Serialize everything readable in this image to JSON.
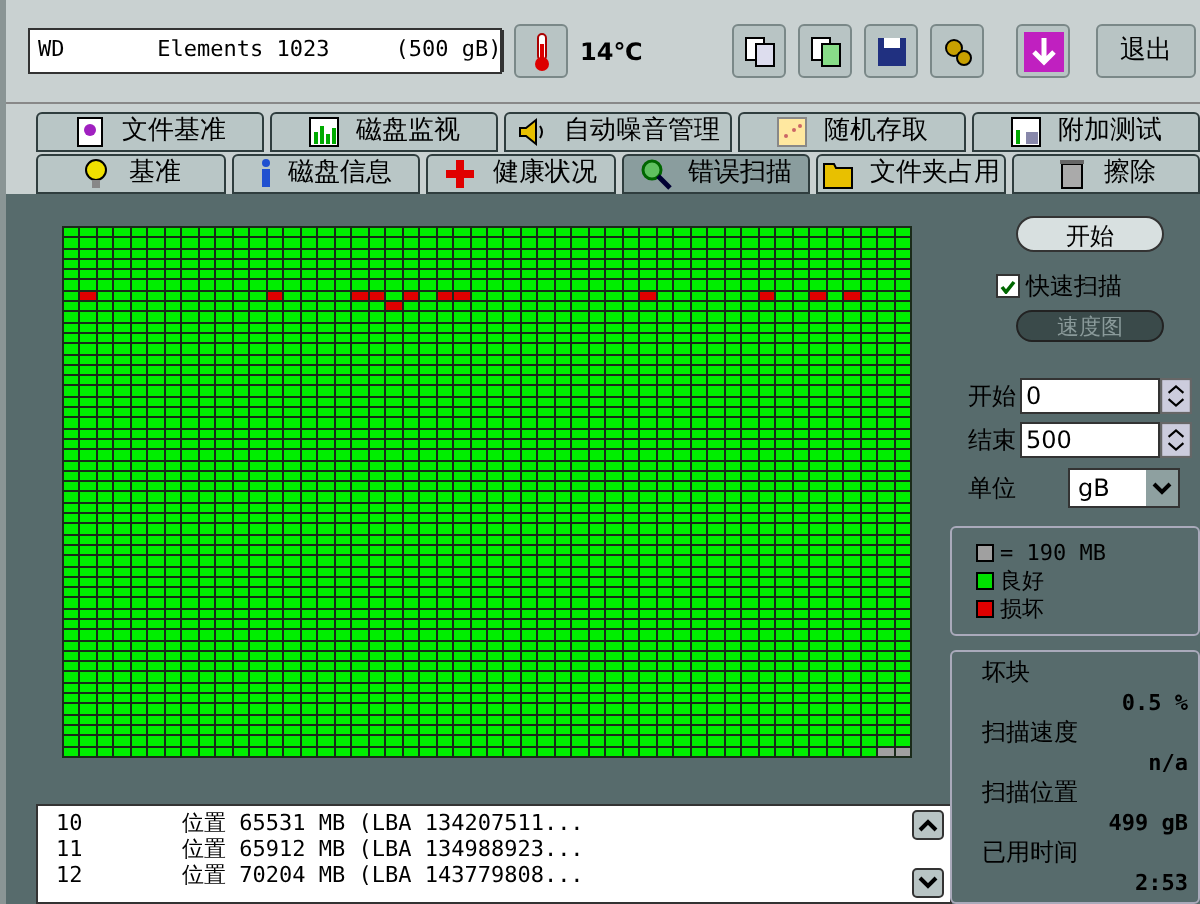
{
  "toolbar": {
    "drive": "WD       Elements 1023     (500 gB)",
    "temperature": "14℃",
    "exit_button": "退出"
  },
  "tabs_top": [
    {
      "label": "文件基准",
      "selected": false
    },
    {
      "label": "磁盘监视",
      "selected": false
    },
    {
      "label": "自动噪音管理",
      "selected": false
    },
    {
      "label": "随机存取",
      "selected": false
    },
    {
      "label": "附加测试",
      "selected": false
    }
  ],
  "tabs_bottom": [
    {
      "label": "基准",
      "selected": false
    },
    {
      "label": "磁盘信息",
      "selected": false
    },
    {
      "label": "健康状况",
      "selected": false
    },
    {
      "label": "错误扫描",
      "selected": true
    },
    {
      "label": "文件夹占用",
      "selected": false
    },
    {
      "label": "擦除",
      "selected": false
    }
  ],
  "scan_grid": [
    [
      false,
      false,
      false,
      false,
      false,
      false,
      false,
      false,
      false,
      false,
      false,
      false,
      false,
      false,
      false,
      false,
      false,
      false,
      false,
      false,
      false,
      false,
      false,
      false,
      false,
      false,
      false,
      false,
      false,
      false,
      false,
      false,
      false,
      false,
      false,
      false,
      false,
      false,
      false,
      false,
      false,
      false,
      false,
      false,
      false,
      false,
      false,
      false,
      false,
      false
    ],
    [
      false,
      false,
      false,
      false,
      false,
      false,
      false,
      false,
      false,
      false,
      false,
      false,
      false,
      false,
      false,
      false,
      false,
      false,
      false,
      false,
      false,
      false,
      false,
      false,
      false,
      false,
      false,
      false,
      false,
      false,
      false,
      false,
      false,
      false,
      false,
      false,
      false,
      false,
      false,
      false,
      false,
      false,
      false,
      false,
      false,
      false,
      false,
      false,
      false,
      false
    ],
    [
      false,
      false,
      false,
      false,
      false,
      false,
      false,
      false,
      false,
      false,
      false,
      false,
      false,
      false,
      false,
      false,
      false,
      false,
      false,
      false,
      false,
      false,
      false,
      false,
      false,
      false,
      false,
      false,
      false,
      false,
      false,
      false,
      false,
      false,
      false,
      false,
      false,
      false,
      false,
      false,
      false,
      false,
      false,
      false,
      false,
      false,
      false,
      false,
      false,
      false
    ],
    [
      false,
      false,
      false,
      false,
      false,
      false,
      false,
      false,
      false,
      false,
      false,
      false,
      false,
      false,
      false,
      false,
      false,
      false,
      false,
      false,
      false,
      false,
      false,
      false,
      false,
      false,
      false,
      false,
      false,
      false,
      false,
      false,
      false,
      false,
      false,
      false,
      false,
      false,
      false,
      false,
      false,
      false,
      false,
      false,
      false,
      false,
      false,
      false,
      false,
      false
    ],
    [
      false,
      false,
      false,
      false,
      false,
      false,
      false,
      false,
      false,
      false,
      false,
      false,
      false,
      false,
      false,
      false,
      false,
      false,
      false,
      false,
      false,
      false,
      false,
      false,
      false,
      false,
      false,
      false,
      false,
      false,
      false,
      false,
      false,
      false,
      false,
      false,
      false,
      false,
      false,
      false,
      false,
      false,
      false,
      false,
      false,
      false,
      false,
      false,
      false,
      false
    ],
    [
      false,
      false,
      false,
      false,
      false,
      false,
      false,
      false,
      false,
      false,
      false,
      false,
      false,
      false,
      false,
      false,
      false,
      false,
      false,
      false,
      false,
      false,
      false,
      false,
      false,
      false,
      false,
      false,
      false,
      false,
      false,
      false,
      false,
      false,
      false,
      false,
      false,
      false,
      false,
      false,
      false,
      false,
      false,
      false,
      false,
      false,
      false,
      false,
      false,
      false
    ],
    [
      false,
      true,
      false,
      false,
      false,
      false,
      false,
      false,
      false,
      false,
      false,
      false,
      true,
      false,
      false,
      false,
      false,
      true,
      true,
      false,
      true,
      false,
      true,
      true,
      false,
      false,
      false,
      false,
      false,
      false,
      false,
      false,
      false,
      false,
      true,
      false,
      false,
      false,
      false,
      false,
      false,
      true,
      false,
      false,
      true,
      false,
      true,
      false,
      false,
      false
    ],
    [
      false,
      false,
      false,
      false,
      false,
      false,
      false,
      false,
      false,
      false,
      false,
      false,
      false,
      false,
      false,
      false,
      false,
      false,
      false,
      true,
      false,
      false,
      false,
      false,
      false,
      false,
      false,
      false,
      false,
      false,
      false,
      false,
      false,
      false,
      false,
      false,
      false,
      false,
      false,
      false,
      false,
      false,
      false,
      false,
      false,
      false,
      false,
      false,
      false,
      false
    ],
    [
      false,
      false,
      false,
      false,
      false,
      false,
      false,
      false,
      false,
      false,
      false,
      false,
      false,
      false,
      false,
      false,
      false,
      false,
      false,
      false,
      false,
      false,
      false,
      false,
      false,
      false,
      false,
      false,
      false,
      false,
      false,
      false,
      false,
      false,
      false,
      false,
      false,
      false,
      false,
      false,
      false,
      false,
      false,
      false,
      false,
      false,
      false,
      false,
      false,
      false
    ],
    [
      false,
      false,
      false,
      false,
      false,
      false,
      false,
      false,
      false,
      false,
      false,
      false,
      false,
      false,
      false,
      false,
      false,
      false,
      false,
      false,
      false,
      false,
      false,
      false,
      false,
      false,
      false,
      false,
      false,
      false,
      false,
      false,
      false,
      false,
      false,
      false,
      false,
      false,
      false,
      false,
      false,
      false,
      false,
      false,
      false,
      false,
      false,
      false,
      false,
      false
    ],
    [
      false,
      false,
      false,
      false,
      false,
      false,
      false,
      false,
      false,
      false,
      false,
      false,
      false,
      false,
      false,
      false,
      false,
      false,
      false,
      false,
      false,
      false,
      false,
      false,
      false,
      false,
      false,
      false,
      false,
      false,
      false,
      false,
      false,
      false,
      false,
      false,
      false,
      false,
      false,
      false,
      false,
      false,
      false,
      false,
      false,
      false,
      false,
      false,
      false,
      false
    ],
    [
      false,
      false,
      false,
      false,
      false,
      false,
      false,
      false,
      false,
      false,
      false,
      false,
      false,
      false,
      false,
      false,
      false,
      false,
      false,
      false,
      false,
      false,
      false,
      false,
      false,
      false,
      false,
      false,
      false,
      false,
      false,
      false,
      false,
      false,
      false,
      false,
      false,
      false,
      false,
      false,
      false,
      false,
      false,
      false,
      false,
      false,
      false,
      false,
      false,
      false
    ],
    [
      false,
      false,
      false,
      false,
      false,
      false,
      false,
      false,
      false,
      false,
      false,
      false,
      false,
      false,
      false,
      false,
      false,
      false,
      false,
      false,
      false,
      false,
      false,
      false,
      false,
      false,
      false,
      false,
      false,
      false,
      false,
      false,
      false,
      false,
      false,
      false,
      false,
      false,
      false,
      false,
      false,
      false,
      false,
      false,
      false,
      false,
      false,
      false,
      false,
      false
    ],
    [
      false,
      false,
      false,
      false,
      false,
      false,
      false,
      false,
      false,
      false,
      false,
      false,
      false,
      false,
      false,
      false,
      false,
      false,
      false,
      false,
      false,
      false,
      false,
      false,
      false,
      false,
      false,
      false,
      false,
      false,
      false,
      false,
      false,
      false,
      false,
      false,
      false,
      false,
      false,
      false,
      false,
      false,
      false,
      false,
      false,
      false,
      false,
      false,
      false,
      false
    ],
    [
      false,
      false,
      false,
      false,
      false,
      false,
      false,
      false,
      false,
      false,
      false,
      false,
      false,
      false,
      false,
      false,
      false,
      false,
      false,
      false,
      false,
      false,
      false,
      false,
      false,
      false,
      false,
      false,
      false,
      false,
      false,
      false,
      false,
      false,
      false,
      false,
      false,
      false,
      false,
      false,
      false,
      false,
      false,
      false,
      false,
      false,
      false,
      false,
      false,
      false
    ],
    [
      false,
      false,
      false,
      false,
      false,
      false,
      false,
      false,
      false,
      false,
      false,
      false,
      false,
      false,
      false,
      false,
      false,
      false,
      false,
      false,
      false,
      false,
      false,
      false,
      false,
      false,
      false,
      false,
      false,
      false,
      false,
      false,
      false,
      false,
      false,
      false,
      false,
      false,
      false,
      false,
      false,
      false,
      false,
      false,
      false,
      false,
      false,
      false,
      false,
      false
    ],
    [
      false,
      false,
      false,
      false,
      false,
      false,
      false,
      false,
      false,
      false,
      false,
      false,
      false,
      false,
      false,
      false,
      false,
      false,
      false,
      false,
      false,
      false,
      false,
      false,
      false,
      false,
      false,
      false,
      false,
      false,
      false,
      false,
      false,
      false,
      false,
      false,
      false,
      false,
      false,
      false,
      false,
      false,
      false,
      false,
      false,
      false,
      false,
      false,
      false,
      false
    ],
    [
      false,
      false,
      false,
      false,
      false,
      false,
      false,
      false,
      false,
      false,
      false,
      false,
      false,
      false,
      false,
      false,
      false,
      false,
      false,
      false,
      false,
      false,
      false,
      false,
      false,
      false,
      false,
      false,
      false,
      false,
      false,
      false,
      false,
      false,
      false,
      false,
      false,
      false,
      false,
      false,
      false,
      false,
      false,
      false,
      false,
      false,
      false,
      false,
      false,
      false
    ],
    [
      false,
      false,
      false,
      false,
      false,
      false,
      false,
      false,
      false,
      false,
      false,
      false,
      false,
      false,
      false,
      false,
      false,
      false,
      false,
      false,
      false,
      false,
      false,
      false,
      false,
      false,
      false,
      false,
      false,
      false,
      false,
      false,
      false,
      false,
      false,
      false,
      false,
      false,
      false,
      false,
      false,
      false,
      false,
      false,
      false,
      false,
      false,
      false,
      false,
      false
    ],
    [
      false,
      false,
      false,
      false,
      false,
      false,
      false,
      false,
      false,
      false,
      false,
      false,
      false,
      false,
      false,
      false,
      false,
      false,
      false,
      false,
      false,
      false,
      false,
      false,
      false,
      false,
      false,
      false,
      false,
      false,
      false,
      false,
      false,
      false,
      false,
      false,
      false,
      false,
      false,
      false,
      false,
      false,
      false,
      false,
      false,
      false,
      false,
      false,
      false,
      false
    ],
    [
      false,
      false,
      false,
      false,
      false,
      false,
      false,
      false,
      false,
      false,
      false,
      false,
      false,
      false,
      false,
      false,
      false,
      false,
      false,
      false,
      false,
      false,
      false,
      false,
      false,
      false,
      false,
      false,
      false,
      false,
      false,
      false,
      false,
      false,
      false,
      false,
      false,
      false,
      false,
      false,
      false,
      false,
      false,
      false,
      false,
      false,
      false,
      false,
      false,
      false
    ],
    [
      false,
      false,
      false,
      false,
      false,
      false,
      false,
      false,
      false,
      false,
      false,
      false,
      false,
      false,
      false,
      false,
      false,
      false,
      false,
      false,
      false,
      false,
      false,
      false,
      false,
      false,
      false,
      false,
      false,
      false,
      false,
      false,
      false,
      false,
      false,
      false,
      false,
      false,
      false,
      false,
      false,
      false,
      false,
      false,
      false,
      false,
      false,
      false,
      false,
      false
    ],
    [
      false,
      false,
      false,
      false,
      false,
      false,
      false,
      false,
      false,
      false,
      false,
      false,
      false,
      false,
      false,
      false,
      false,
      false,
      false,
      false,
      false,
      false,
      false,
      false,
      false,
      false,
      false,
      false,
      false,
      false,
      false,
      false,
      false,
      false,
      false,
      false,
      false,
      false,
      false,
      false,
      false,
      false,
      false,
      false,
      false,
      false,
      false,
      false,
      false,
      false
    ],
    [
      false,
      false,
      false,
      false,
      false,
      false,
      false,
      false,
      false,
      false,
      false,
      false,
      false,
      false,
      false,
      false,
      false,
      false,
      false,
      false,
      false,
      false,
      false,
      false,
      false,
      false,
      false,
      false,
      false,
      false,
      false,
      false,
      false,
      false,
      false,
      false,
      false,
      false,
      false,
      false,
      false,
      false,
      false,
      false,
      false,
      false,
      false,
      false,
      false,
      false
    ],
    [
      false,
      false,
      false,
      false,
      false,
      false,
      false,
      false,
      false,
      false,
      false,
      false,
      false,
      false,
      false,
      false,
      false,
      false,
      false,
      false,
      false,
      false,
      false,
      false,
      false,
      false,
      false,
      false,
      false,
      false,
      false,
      false,
      false,
      false,
      false,
      false,
      false,
      false,
      false,
      false,
      false,
      false,
      false,
      false,
      false,
      false,
      false,
      false,
      false,
      false
    ],
    [
      false,
      false,
      false,
      false,
      false,
      false,
      false,
      false,
      false,
      false,
      false,
      false,
      false,
      false,
      false,
      false,
      false,
      false,
      false,
      false,
      false,
      false,
      false,
      false,
      false,
      false,
      false,
      false,
      false,
      false,
      false,
      false,
      false,
      false,
      false,
      false,
      false,
      false,
      false,
      false,
      false,
      false,
      false,
      false,
      false,
      false,
      false,
      false,
      false,
      false
    ],
    [
      false,
      false,
      false,
      false,
      false,
      false,
      false,
      false,
      false,
      false,
      false,
      false,
      false,
      false,
      false,
      false,
      false,
      false,
      false,
      false,
      false,
      false,
      false,
      false,
      false,
      false,
      false,
      false,
      false,
      false,
      false,
      false,
      false,
      false,
      false,
      false,
      false,
      false,
      false,
      false,
      false,
      false,
      false,
      false,
      false,
      false,
      false,
      false,
      false,
      false
    ],
    [
      false,
      false,
      false,
      false,
      false,
      false,
      false,
      false,
      false,
      false,
      false,
      false,
      false,
      false,
      false,
      false,
      false,
      false,
      false,
      false,
      false,
      false,
      false,
      false,
      false,
      false,
      false,
      false,
      false,
      false,
      false,
      false,
      false,
      false,
      false,
      false,
      false,
      false,
      false,
      false,
      false,
      false,
      false,
      false,
      false,
      false,
      false,
      false,
      false,
      false
    ],
    [
      false,
      false,
      false,
      false,
      false,
      false,
      false,
      false,
      false,
      false,
      false,
      false,
      false,
      false,
      false,
      false,
      false,
      false,
      false,
      false,
      false,
      false,
      false,
      false,
      false,
      false,
      false,
      false,
      false,
      false,
      false,
      false,
      false,
      false,
      false,
      false,
      false,
      false,
      false,
      false,
      false,
      false,
      false,
      false,
      false,
      false,
      false,
      false,
      false,
      false
    ],
    [
      false,
      false,
      false,
      false,
      false,
      false,
      false,
      false,
      false,
      false,
      false,
      false,
      false,
      false,
      false,
      false,
      false,
      false,
      false,
      false,
      false,
      false,
      false,
      false,
      false,
      false,
      false,
      false,
      false,
      false,
      false,
      false,
      false,
      false,
      false,
      false,
      false,
      false,
      false,
      false,
      false,
      false,
      false,
      false,
      false,
      false,
      false,
      false,
      false,
      false
    ],
    [
      false,
      false,
      false,
      false,
      false,
      false,
      false,
      false,
      false,
      false,
      false,
      false,
      false,
      false,
      false,
      false,
      false,
      false,
      false,
      false,
      false,
      false,
      false,
      false,
      false,
      false,
      false,
      false,
      false,
      false,
      false,
      false,
      false,
      false,
      false,
      false,
      false,
      false,
      false,
      false,
      false,
      false,
      false,
      false,
      false,
      false,
      false,
      false,
      false,
      false
    ],
    [
      false,
      false,
      false,
      false,
      false,
      false,
      false,
      false,
      false,
      false,
      false,
      false,
      false,
      false,
      false,
      false,
      false,
      false,
      false,
      false,
      false,
      false,
      false,
      false,
      false,
      false,
      false,
      false,
      false,
      false,
      false,
      false,
      false,
      false,
      false,
      false,
      false,
      false,
      false,
      false,
      false,
      false,
      false,
      false,
      false,
      false,
      false,
      false,
      false,
      false
    ],
    [
      false,
      false,
      false,
      false,
      false,
      false,
      false,
      false,
      false,
      false,
      false,
      false,
      false,
      false,
      false,
      false,
      false,
      false,
      false,
      false,
      false,
      false,
      false,
      false,
      false,
      false,
      false,
      false,
      false,
      false,
      false,
      false,
      false,
      false,
      false,
      false,
      false,
      false,
      false,
      false,
      false,
      false,
      false,
      false,
      false,
      false,
      false,
      false,
      false,
      false
    ],
    [
      false,
      false,
      false,
      false,
      false,
      false,
      false,
      false,
      false,
      false,
      false,
      false,
      false,
      false,
      false,
      false,
      false,
      false,
      false,
      false,
      false,
      false,
      false,
      false,
      false,
      false,
      false,
      false,
      false,
      false,
      false,
      false,
      false,
      false,
      false,
      false,
      false,
      false,
      false,
      false,
      false,
      false,
      false,
      false,
      false,
      false,
      false,
      false,
      false,
      false
    ],
    [
      false,
      false,
      false,
      false,
      false,
      false,
      false,
      false,
      false,
      false,
      false,
      false,
      false,
      false,
      false,
      false,
      false,
      false,
      false,
      false,
      false,
      false,
      false,
      false,
      false,
      false,
      false,
      false,
      false,
      false,
      false,
      false,
      false,
      false,
      false,
      false,
      false,
      false,
      false,
      false,
      false,
      false,
      false,
      false,
      false,
      false,
      false,
      false,
      false,
      false
    ],
    [
      false,
      false,
      false,
      false,
      false,
      false,
      false,
      false,
      false,
      false,
      false,
      false,
      false,
      false,
      false,
      false,
      false,
      false,
      false,
      false,
      false,
      false,
      false,
      false,
      false,
      false,
      false,
      false,
      false,
      false,
      false,
      false,
      false,
      false,
      false,
      false,
      false,
      false,
      false,
      false,
      false,
      false,
      false,
      false,
      false,
      false,
      false,
      false,
      false,
      false
    ],
    [
      false,
      false,
      false,
      false,
      false,
      false,
      false,
      false,
      false,
      false,
      false,
      false,
      false,
      false,
      false,
      false,
      false,
      false,
      false,
      false,
      false,
      false,
      false,
      false,
      false,
      false,
      false,
      false,
      false,
      false,
      false,
      false,
      false,
      false,
      false,
      false,
      false,
      false,
      false,
      false,
      false,
      false,
      false,
      false,
      false,
      false,
      false,
      false,
      false,
      false
    ],
    [
      false,
      false,
      false,
      false,
      false,
      false,
      false,
      false,
      false,
      false,
      false,
      false,
      false,
      false,
      false,
      false,
      false,
      false,
      false,
      false,
      false,
      false,
      false,
      false,
      false,
      false,
      false,
      false,
      false,
      false,
      false,
      false,
      false,
      false,
      false,
      false,
      false,
      false,
      false,
      false,
      false,
      false,
      false,
      false,
      false,
      false,
      false,
      false,
      false,
      false
    ],
    [
      false,
      false,
      false,
      false,
      false,
      false,
      false,
      false,
      false,
      false,
      false,
      false,
      false,
      false,
      false,
      false,
      false,
      false,
      false,
      false,
      false,
      false,
      false,
      false,
      false,
      false,
      false,
      false,
      false,
      false,
      false,
      false,
      false,
      false,
      false,
      false,
      false,
      false,
      false,
      false,
      false,
      false,
      false,
      false,
      false,
      false,
      false,
      false,
      false,
      false
    ],
    [
      false,
      false,
      false,
      false,
      false,
      false,
      false,
      false,
      false,
      false,
      false,
      false,
      false,
      false,
      false,
      false,
      false,
      false,
      false,
      false,
      false,
      false,
      false,
      false,
      false,
      false,
      false,
      false,
      false,
      false,
      false,
      false,
      false,
      false,
      false,
      false,
      false,
      false,
      false,
      false,
      false,
      false,
      false,
      false,
      false,
      false,
      false,
      false,
      false,
      false
    ],
    [
      false,
      false,
      false,
      false,
      false,
      false,
      false,
      false,
      false,
      false,
      false,
      false,
      false,
      false,
      false,
      false,
      false,
      false,
      false,
      false,
      false,
      false,
      false,
      false,
      false,
      false,
      false,
      false,
      false,
      false,
      false,
      false,
      false,
      false,
      false,
      false,
      false,
      false,
      false,
      false,
      false,
      false,
      false,
      false,
      false,
      false,
      false,
      false,
      false,
      false
    ],
    [
      false,
      false,
      false,
      false,
      false,
      false,
      false,
      false,
      false,
      false,
      false,
      false,
      false,
      false,
      false,
      false,
      false,
      false,
      false,
      false,
      false,
      false,
      false,
      false,
      false,
      false,
      false,
      false,
      false,
      false,
      false,
      false,
      false,
      false,
      false,
      false,
      false,
      false,
      false,
      false,
      false,
      false,
      false,
      false,
      false,
      false,
      false,
      false,
      false,
      false
    ],
    [
      false,
      false,
      false,
      false,
      false,
      false,
      false,
      false,
      false,
      false,
      false,
      false,
      false,
      false,
      false,
      false,
      false,
      false,
      false,
      false,
      false,
      false,
      false,
      false,
      false,
      false,
      false,
      false,
      false,
      false,
      false,
      false,
      false,
      false,
      false,
      false,
      false,
      false,
      false,
      false,
      false,
      false,
      false,
      false,
      false,
      false,
      false,
      false,
      false,
      false
    ],
    [
      false,
      false,
      false,
      false,
      false,
      false,
      false,
      false,
      false,
      false,
      false,
      false,
      false,
      false,
      false,
      false,
      false,
      false,
      false,
      false,
      false,
      false,
      false,
      false,
      false,
      false,
      false,
      false,
      false,
      false,
      false,
      false,
      false,
      false,
      false,
      false,
      false,
      false,
      false,
      false,
      false,
      false,
      false,
      false,
      false,
      false,
      false,
      false,
      false,
      false
    ],
    [
      false,
      false,
      false,
      false,
      false,
      false,
      false,
      false,
      false,
      false,
      false,
      false,
      false,
      false,
      false,
      false,
      false,
      false,
      false,
      false,
      false,
      false,
      false,
      false,
      false,
      false,
      false,
      false,
      false,
      false,
      false,
      false,
      false,
      false,
      false,
      false,
      false,
      false,
      false,
      false,
      false,
      false,
      false,
      false,
      false,
      false,
      false,
      false,
      false,
      false
    ],
    [
      false,
      false,
      false,
      false,
      false,
      false,
      false,
      false,
      false,
      false,
      false,
      false,
      false,
      false,
      false,
      false,
      false,
      false,
      false,
      false,
      false,
      false,
      false,
      false,
      false,
      false,
      false,
      false,
      false,
      false,
      false,
      false,
      false,
      false,
      false,
      false,
      false,
      false,
      false,
      false,
      false,
      false,
      false,
      false,
      false,
      false,
      false,
      false,
      false,
      false
    ],
    [
      false,
      false,
      false,
      false,
      false,
      false,
      false,
      false,
      false,
      false,
      false,
      false,
      false,
      false,
      false,
      false,
      false,
      false,
      false,
      false,
      false,
      false,
      false,
      false,
      false,
      false,
      false,
      false,
      false,
      false,
      false,
      false,
      false,
      false,
      false,
      false,
      false,
      false,
      false,
      false,
      false,
      false,
      false,
      false,
      false,
      false,
      false,
      false,
      false,
      false
    ],
    [
      false,
      false,
      false,
      false,
      false,
      false,
      false,
      false,
      false,
      false,
      false,
      false,
      false,
      false,
      false,
      false,
      false,
      false,
      false,
      false,
      false,
      false,
      false,
      false,
      false,
      false,
      false,
      false,
      false,
      false,
      false,
      false,
      false,
      false,
      false,
      false,
      false,
      false,
      false,
      false,
      false,
      false,
      false,
      false,
      false,
      false,
      false,
      false,
      false,
      false
    ],
    [
      false,
      false,
      false,
      false,
      false,
      false,
      false,
      false,
      false,
      false,
      false,
      false,
      false,
      false,
      false,
      false,
      false,
      false,
      false,
      false,
      false,
      false,
      false,
      false,
      false,
      false,
      false,
      false,
      false,
      false,
      false,
      false,
      false,
      false,
      false,
      false,
      false,
      false,
      false,
      false,
      false,
      false,
      false,
      false,
      false,
      false,
      false,
      false,
      false,
      false
    ],
    [
      false,
      false,
      false,
      false,
      false,
      false,
      false,
      false,
      false,
      false,
      false,
      false,
      false,
      false,
      false,
      false,
      false,
      false,
      false,
      false,
      false,
      false,
      false,
      false,
      false,
      false,
      false,
      false,
      false,
      false,
      false,
      false,
      false,
      false,
      false,
      false,
      false,
      false,
      false,
      false,
      false,
      false,
      false,
      false,
      false,
      false,
      false,
      false
    ]
  ],
  "log": [
    {
      "index": "10",
      "text": "位置 65531 MB (LBA 134207511..."
    },
    {
      "index": "11",
      "text": "位置 65912 MB (LBA 134988923..."
    },
    {
      "index": "12",
      "text": "位置 70204 MB (LBA 143779808..."
    }
  ],
  "controls": {
    "start_button": "开始",
    "quick_scan": {
      "label": "快速扫描",
      "checked": true
    },
    "speed_map_button": {
      "label": "速度图",
      "disabled": true
    },
    "start_label": "开始",
    "start_value": "0",
    "end_label": "结束",
    "end_value": "500",
    "unit_label": "单位",
    "unit_value": "gB"
  },
  "legend": [
    {
      "kind": "unused",
      "label": "= 190 MB",
      "color": "#a0a0a0"
    },
    {
      "kind": "good",
      "label": "良好",
      "color": "#00e000"
    },
    {
      "kind": "bad",
      "label": "损坏",
      "color": "#e00000"
    }
  ],
  "stats": [
    {
      "label": "坏块",
      "value": "0.5 %"
    },
    {
      "label": "扫描速度",
      "value": "n/a"
    },
    {
      "label": "扫描位置",
      "value": "499 gB"
    },
    {
      "label": "已用时间",
      "value": "2:53"
    }
  ]
}
